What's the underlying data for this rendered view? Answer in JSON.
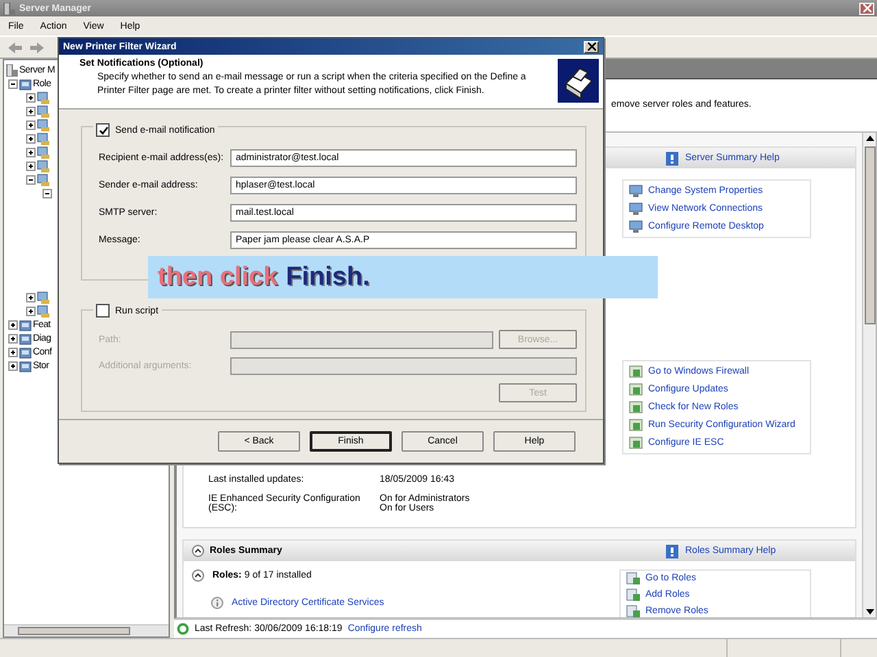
{
  "window": {
    "title": "Server Manager"
  },
  "menu": [
    "File",
    "Action",
    "View",
    "Help"
  ],
  "tree": [
    {
      "label": "Server M",
      "children": [
        {
          "label": "Role",
          "expanded": true,
          "children": [
            {
              "expanded": false
            },
            {
              "expanded": false
            },
            {
              "expanded": false
            },
            {
              "expanded": false
            },
            {
              "expanded": false
            },
            {
              "expanded": false
            },
            {
              "expanded": true,
              "children": [
                {
                  "expanded": true
                }
              ]
            },
            {
              "expanded": false
            },
            {
              "expanded": false
            }
          ]
        },
        {
          "label": "Feat",
          "expanded": false
        },
        {
          "label": "Diag",
          "expanded": false
        },
        {
          "label": "Conf",
          "expanded": false
        },
        {
          "label": "Stor",
          "expanded": false
        }
      ]
    }
  ],
  "description": "emove server roles and features.",
  "server_summary": {
    "help": "Server Summary Help",
    "links": [
      "Change System Properties",
      "View Network Connections",
      "Configure Remote Desktop"
    ],
    "security_links": [
      "Go to Windows Firewall",
      "Configure Updates",
      "Check for New Roles",
      "Run Security Configuration Wizard",
      "Configure IE ESC"
    ],
    "details": [
      {
        "label": "Last installed updates:",
        "values": [
          "18/05/2009 16:43"
        ]
      },
      {
        "label": "IE Enhanced Security Configuration (ESC):",
        "values": [
          "On for Administrators",
          "On for Users"
        ]
      }
    ]
  },
  "roles_summary": {
    "title": "Roles Summary",
    "help": "Roles Summary Help",
    "count": "**Roles:** 9 of 17 installed",
    "roles": [
      "Active Directory Certificate Services"
    ],
    "links": [
      "Go to Roles",
      "Add Roles",
      "Remove Roles"
    ]
  },
  "status": {
    "refresh": "Last Refresh: 30/06/2009 16:18:19",
    "configure": "Configure refresh"
  },
  "dialog": {
    "title": "New Printer Filter Wizard",
    "heading": "Set Notifications (Optional)",
    "description": "Specify whether to send an e-mail message or run a script when the criteria specified on the Define a Printer Filter page are met. To create a printer filter without setting notifications, click Finish.",
    "email": {
      "label": "Send e-mail notification",
      "checked": true,
      "fields": [
        {
          "label": "Recipient e-mail address(es):",
          "value": "administrator@test.local"
        },
        {
          "label": "Sender e-mail address:",
          "value": "hplaser@test.local"
        },
        {
          "label": "SMTP server:",
          "value": "mail.test.local"
        },
        {
          "label": "Message:",
          "value": "Paper jam please clear A.S.A.P"
        }
      ]
    },
    "script": {
      "label": "Run script",
      "checked": false,
      "path": {
        "label": "Path:",
        "disabled": true
      },
      "browse": {
        "label": "Browse...",
        "disabled": true
      },
      "arguments": {
        "label": "Additional arguments:",
        "disabled": true
      },
      "test": {
        "label": "Test",
        "disabled": true
      }
    },
    "buttons": [
      {
        "label": "< Back",
        "default": false
      },
      {
        "label": "Finish",
        "default": true
      },
      {
        "label": "Cancel",
        "default": false
      },
      {
        "label": "Help",
        "default": false
      }
    ]
  },
  "caption": {
    "parts": [
      {
        "text": "then click",
        "kind": "plain"
      },
      {
        "text": "Finish.",
        "kind": "emphasis"
      }
    ]
  }
}
